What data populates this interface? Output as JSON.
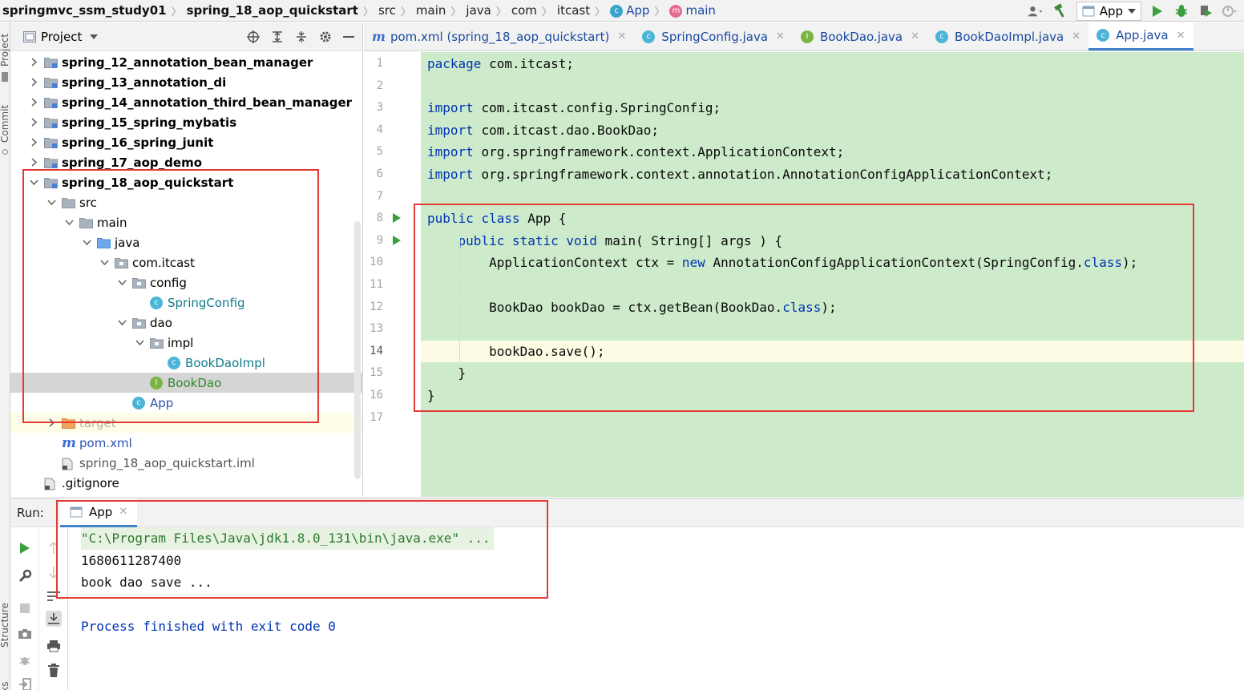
{
  "breadcrumb": {
    "items": [
      {
        "label": "springmvc_ssm_study01",
        "bold": true
      },
      {
        "label": "spring_18_aop_quickstart",
        "bold": true
      },
      {
        "label": "src"
      },
      {
        "label": "main"
      },
      {
        "label": "java"
      },
      {
        "label": "com"
      },
      {
        "label": "itcast"
      },
      {
        "label": "App"
      },
      {
        "label": "main"
      }
    ]
  },
  "toolbar": {
    "run_config": "App",
    "icons": [
      "user-vcs-icon",
      "build-hammer-icon",
      "run-icon",
      "debug-icon",
      "coverage-icon",
      "profile-icon"
    ]
  },
  "left_stripe": {
    "project_label": "Project",
    "commit_label": "Commit",
    "structure_label": "Structure",
    "bookmarks_label": "arks"
  },
  "project": {
    "title": "Project",
    "tree": [
      {
        "label": "spring_12_annotation_bean_manager",
        "depth": 1,
        "kind": "module",
        "expanded": false,
        "bold": true
      },
      {
        "label": "spring_13_annotation_di",
        "depth": 1,
        "kind": "module",
        "expanded": false,
        "bold": true
      },
      {
        "label": "spring_14_annotation_third_bean_manager",
        "depth": 1,
        "kind": "module",
        "expanded": false,
        "bold": true
      },
      {
        "label": "spring_15_spring_mybatis",
        "depth": 1,
        "kind": "module",
        "expanded": false,
        "bold": true
      },
      {
        "label": "spring_16_spring_junit",
        "depth": 1,
        "kind": "module",
        "expanded": false,
        "bold": true
      },
      {
        "label": "spring_17_aop_demo",
        "depth": 1,
        "kind": "module",
        "expanded": false,
        "bold": true
      },
      {
        "label": "spring_18_aop_quickstart",
        "depth": 1,
        "kind": "module",
        "expanded": true,
        "bold": true
      },
      {
        "label": "src",
        "depth": 2,
        "kind": "folder",
        "expanded": true
      },
      {
        "label": "main",
        "depth": 3,
        "kind": "folder",
        "expanded": true
      },
      {
        "label": "java",
        "depth": 4,
        "kind": "source-folder",
        "expanded": true
      },
      {
        "label": "com.itcast",
        "depth": 5,
        "kind": "package",
        "expanded": true
      },
      {
        "label": "config",
        "depth": 6,
        "kind": "package",
        "expanded": true
      },
      {
        "label": "SpringConfig",
        "depth": 7,
        "kind": "class"
      },
      {
        "label": "dao",
        "depth": 6,
        "kind": "package",
        "expanded": true
      },
      {
        "label": "impl",
        "depth": 7,
        "kind": "package",
        "expanded": true
      },
      {
        "label": "BookDaoImpl",
        "depth": 8,
        "kind": "class"
      },
      {
        "label": "BookDao",
        "depth": 7,
        "kind": "interface",
        "selected": true
      },
      {
        "label": "App",
        "depth": 6,
        "kind": "main-class"
      },
      {
        "label": "target",
        "depth": 2,
        "kind": "excluded-folder",
        "expanded": false
      },
      {
        "label": "pom.xml",
        "depth": 2,
        "kind": "maven"
      },
      {
        "label": "spring_18_aop_quickstart.iml",
        "depth": 2,
        "kind": "iml"
      },
      {
        "label": ".gitignore",
        "depth": 1,
        "kind": "gitignore"
      }
    ]
  },
  "editor": {
    "tabs": [
      {
        "label": "pom.xml (spring_18_aop_quickstart)",
        "icon": "maven-icon"
      },
      {
        "label": "SpringConfig.java",
        "icon": "class-icon"
      },
      {
        "label": "BookDao.java",
        "icon": "interface-icon"
      },
      {
        "label": "BookDaoImpl.java",
        "icon": "class-icon"
      },
      {
        "label": "App.java",
        "icon": "main-class-icon",
        "active": true
      }
    ],
    "current_line": 14,
    "lines": [
      {
        "n": "1",
        "text": "package com.itcast;"
      },
      {
        "n": "2",
        "text": ""
      },
      {
        "n": "3",
        "text": "import com.itcast.config.SpringConfig;"
      },
      {
        "n": "4",
        "text": "import com.itcast.dao.BookDao;"
      },
      {
        "n": "5",
        "text": "import org.springframework.context.ApplicationContext;"
      },
      {
        "n": "6",
        "text": "import org.springframework.context.annotation.AnnotationConfigApplicationContext;"
      },
      {
        "n": "7",
        "text": ""
      },
      {
        "n": "8",
        "text": "public class App {"
      },
      {
        "n": "9",
        "text": "    public static void main( String[] args ) {"
      },
      {
        "n": "10",
        "text": "        ApplicationContext ctx = new AnnotationConfigApplicationContext(SpringConfig.class);"
      },
      {
        "n": "11",
        "text": ""
      },
      {
        "n": "12",
        "text": "        BookDao bookDao = ctx.getBean(BookDao.class);"
      },
      {
        "n": "13",
        "text": ""
      },
      {
        "n": "14",
        "text": "        bookDao.save();"
      },
      {
        "n": "15",
        "text": "    }"
      },
      {
        "n": "16",
        "text": "}"
      },
      {
        "n": "17",
        "text": ""
      }
    ]
  },
  "run": {
    "label": "Run:",
    "tab_label": "App",
    "output": [
      {
        "text": "\"C:\\Program Files\\Java\\jdk1.8.0_131\\bin\\java.exe\" ...",
        "kind": "cmd"
      },
      {
        "text": "1680611287400",
        "kind": "plain"
      },
      {
        "text": "book dao save ...",
        "kind": "plain"
      },
      {
        "text": "",
        "kind": "plain"
      },
      {
        "text": "Process finished with exit code 0",
        "kind": "done"
      }
    ]
  },
  "colors": {
    "editor_highlight": "#cdebca",
    "annotation_red": "#e53935",
    "keyword": "#0033b3",
    "accent": "#4083c9"
  }
}
